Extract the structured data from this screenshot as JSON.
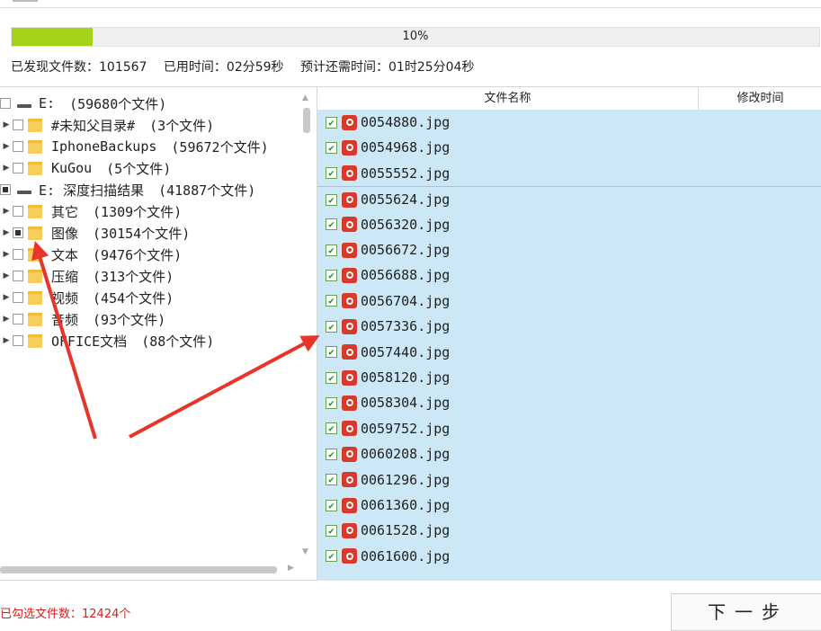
{
  "progress": {
    "percent": 10,
    "label": "10%",
    "fill_color": "#a4d21a"
  },
  "stats": {
    "found": "已发现文件数：101567",
    "elapsed": "已用时间：02分59秒",
    "remaining": "预计还需时间：01时25分04秒"
  },
  "tree": [
    {
      "label": "E:",
      "count": "(59680个文件)",
      "type": "drive",
      "check": "none",
      "expand": false,
      "indent": 0
    },
    {
      "label": "#未知父目录#",
      "count": "(3个文件)",
      "type": "folder",
      "check": "none",
      "expand": true,
      "indent": 1
    },
    {
      "label": "IphoneBackups",
      "count": "(59672个文件)",
      "type": "folder",
      "check": "none",
      "expand": true,
      "indent": 1
    },
    {
      "label": "KuGou",
      "count": "(5个文件)",
      "type": "folder",
      "check": "none",
      "expand": true,
      "indent": 1
    },
    {
      "label": "E: 深度扫描结果",
      "count": "(41887个文件)",
      "type": "drive",
      "check": "partial",
      "expand": false,
      "indent": 0
    },
    {
      "label": "其它",
      "count": "(1309个文件)",
      "type": "folder",
      "check": "none",
      "expand": true,
      "indent": 1
    },
    {
      "label": "图像",
      "count": "(30154个文件)",
      "type": "folder",
      "check": "partial",
      "expand": true,
      "indent": 1
    },
    {
      "label": "文本",
      "count": "(9476个文件)",
      "type": "folder",
      "check": "none",
      "expand": true,
      "indent": 1
    },
    {
      "label": "压缩",
      "count": "(313个文件)",
      "type": "folder",
      "check": "none",
      "expand": true,
      "indent": 1
    },
    {
      "label": "视频",
      "count": "(454个文件)",
      "type": "folder",
      "check": "none",
      "expand": true,
      "indent": 1
    },
    {
      "label": "音频",
      "count": "(93个文件)",
      "type": "folder",
      "check": "none",
      "expand": true,
      "indent": 1
    },
    {
      "label": "OFFICE文档",
      "count": "(88个文件)",
      "type": "folder",
      "check": "none",
      "expand": true,
      "indent": 1
    }
  ],
  "list": {
    "col_name": "文件名称",
    "col_time": "修改时间",
    "files": [
      "0054880.jpg",
      "0054968.jpg",
      "0055552.jpg",
      "0055624.jpg",
      "0056320.jpg",
      "0056672.jpg",
      "0056688.jpg",
      "0056704.jpg",
      "0057336.jpg",
      "0057440.jpg",
      "0058120.jpg",
      "0058304.jpg",
      "0059752.jpg",
      "0060208.jpg",
      "0061296.jpg",
      "0061360.jpg",
      "0061528.jpg",
      "0061600.jpg"
    ]
  },
  "bottom": {
    "status": "已勾选文件数：12424个",
    "next_label": "下一步"
  },
  "colors": {
    "list_selected_bg": "#cce8f7",
    "arrow": "#e8352a"
  }
}
